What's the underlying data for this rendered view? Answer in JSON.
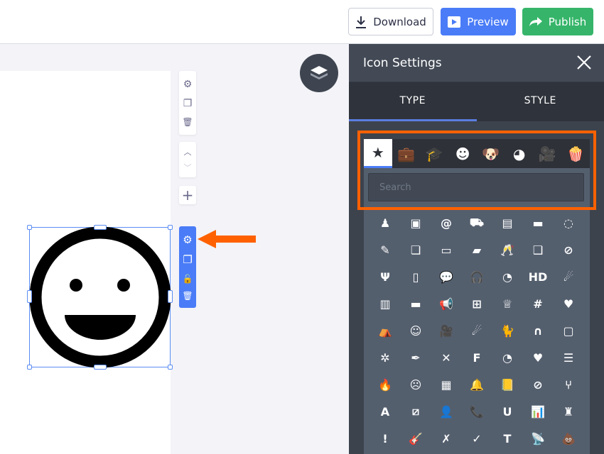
{
  "header": {
    "download_label": "Download",
    "preview_label": "Preview",
    "publish_label": "Publish"
  },
  "canvas": {
    "page_toolbar": [
      {
        "name": "page-settings-icon",
        "glyph": "⚙"
      },
      {
        "name": "duplicate-icon",
        "glyph": "❐"
      },
      {
        "name": "trash-icon",
        "glyph": "🗑"
      }
    ],
    "move": [
      {
        "name": "chevron-up-icon",
        "glyph": "︿"
      },
      {
        "name": "chevron-down-icon",
        "glyph": "﹀"
      }
    ],
    "add": {
      "glyph": "+"
    },
    "element_toolbar": [
      {
        "name": "gear-icon",
        "glyph": "⚙"
      },
      {
        "name": "duplicate-icon",
        "glyph": "❐"
      },
      {
        "name": "unlock-icon",
        "glyph": "🔓"
      },
      {
        "name": "trash-icon",
        "glyph": "🗑"
      }
    ],
    "accent": "#4a7cf7",
    "annotation_color": "#ff6100"
  },
  "panel": {
    "title": "Icon Settings",
    "tabs": [
      {
        "label": "TYPE",
        "active": true
      },
      {
        "label": "STYLE",
        "active": false
      }
    ],
    "categories": [
      {
        "name": "star",
        "glyph": "★"
      },
      {
        "name": "briefcase",
        "glyph": "💼"
      },
      {
        "name": "graduation-cap",
        "glyph": "🎓"
      },
      {
        "name": "smiley",
        "glyph": "☻"
      },
      {
        "name": "dog",
        "glyph": "🐶"
      },
      {
        "name": "pacman",
        "glyph": "◕"
      },
      {
        "name": "video-camera",
        "glyph": "🎥"
      },
      {
        "name": "popcorn",
        "glyph": "🍿"
      }
    ],
    "search_placeholder": "Search",
    "icons": [
      {
        "name": "stamp",
        "g": "♟"
      },
      {
        "name": "treasure-chest",
        "g": "▣"
      },
      {
        "name": "snail",
        "g": "@"
      },
      {
        "name": "caravan",
        "g": "⛟"
      },
      {
        "name": "jar",
        "g": "▤"
      },
      {
        "name": "chat-message",
        "g": "▬"
      },
      {
        "name": "cookie",
        "g": "◌"
      },
      {
        "name": "broom",
        "g": "✎"
      },
      {
        "name": "cards",
        "g": "❏"
      },
      {
        "name": "archive",
        "g": "▭"
      },
      {
        "name": "gold-bars",
        "g": "▰"
      },
      {
        "name": "champagne",
        "g": "🥂"
      },
      {
        "name": "chats",
        "g": "❑"
      },
      {
        "name": "compass",
        "g": "⊘"
      },
      {
        "name": "slingshot",
        "g": "Ψ"
      },
      {
        "name": "domino",
        "g": "▯"
      },
      {
        "name": "speech-bubble",
        "g": "💬"
      },
      {
        "name": "headphones",
        "g": "🎧"
      },
      {
        "name": "protractor",
        "g": "◔"
      },
      {
        "name": "hd",
        "g": "HD"
      },
      {
        "name": "meteor-shower",
        "g": "☄"
      },
      {
        "name": "crib",
        "g": "▥"
      },
      {
        "name": "wallet",
        "g": "▬"
      },
      {
        "name": "megaphone",
        "g": "📢"
      },
      {
        "name": "video-add",
        "g": "⊞"
      },
      {
        "name": "crown",
        "g": "♕"
      },
      {
        "name": "tic-tac-toe",
        "g": "#"
      },
      {
        "name": "heart-card",
        "g": "♥"
      },
      {
        "name": "tent",
        "g": "⛺"
      },
      {
        "name": "theater-masks",
        "g": "☺"
      },
      {
        "name": "film-camera",
        "g": "🎥"
      },
      {
        "name": "meteor",
        "g": "☄"
      },
      {
        "name": "cat",
        "g": "🐈"
      },
      {
        "name": "magnet-arch",
        "g": "∩"
      },
      {
        "name": "hd-outline",
        "g": "▢"
      },
      {
        "name": "pacifier",
        "g": "✲"
      },
      {
        "name": "feather",
        "g": "✒"
      },
      {
        "name": "treasure-map",
        "g": "✕"
      },
      {
        "name": "file-f",
        "g": "F"
      },
      {
        "name": "pie-chart",
        "g": "◔"
      },
      {
        "name": "cupid-arrow",
        "g": "♥"
      },
      {
        "name": "coin-stacks",
        "g": "☰"
      },
      {
        "name": "fire",
        "g": "🔥"
      },
      {
        "name": "devil",
        "g": "☹"
      },
      {
        "name": "calculator",
        "g": "▦"
      },
      {
        "name": "bell-ringing",
        "g": "🔔"
      },
      {
        "name": "contact-book",
        "g": "📒"
      },
      {
        "name": "video-off",
        "g": "⊘"
      },
      {
        "name": "armchair",
        "g": "⑂"
      },
      {
        "name": "file-a",
        "g": "A"
      },
      {
        "name": "crop-off",
        "g": "⧄"
      },
      {
        "name": "user",
        "g": "👤"
      },
      {
        "name": "phone-outgoing",
        "g": "📞"
      },
      {
        "name": "magnet",
        "g": "U"
      },
      {
        "name": "bar-chart",
        "g": "📊"
      },
      {
        "name": "trophy-figure",
        "g": "♜"
      },
      {
        "name": "alert-bubble",
        "g": "!"
      },
      {
        "name": "guitar",
        "g": "🎸"
      },
      {
        "name": "user-remove",
        "g": "✗"
      },
      {
        "name": "user-check",
        "g": "✓"
      },
      {
        "name": "text-box",
        "g": "T"
      },
      {
        "name": "satellite-dish",
        "g": "📡"
      },
      {
        "name": "poop",
        "g": "💩"
      }
    ]
  }
}
